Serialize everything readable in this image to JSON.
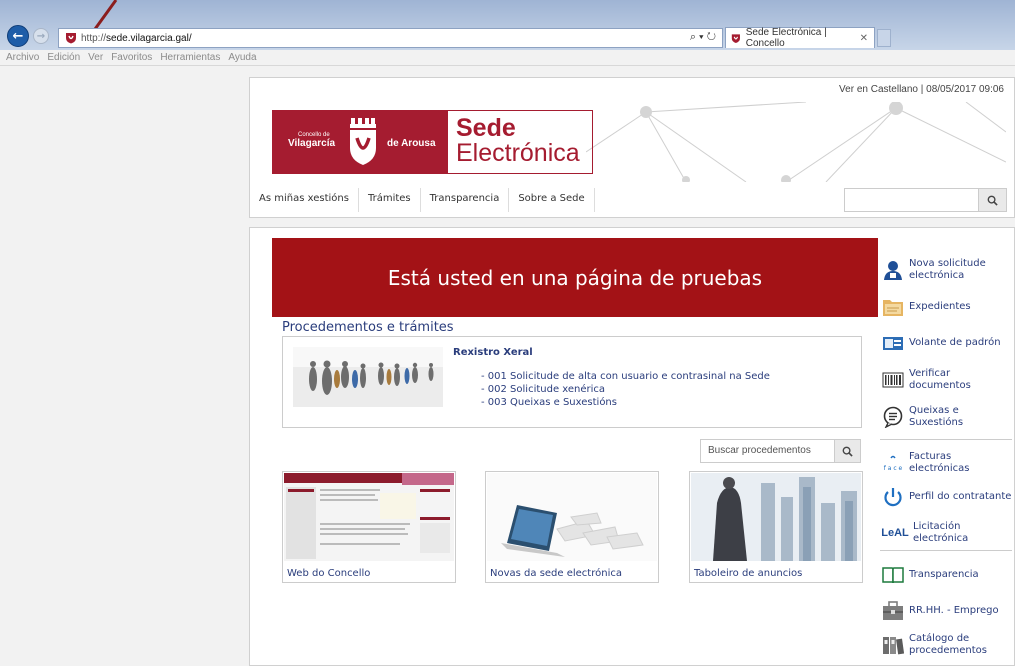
{
  "browser": {
    "url_prefix": "http://",
    "url_domain": "sede.vilagarcia.gal/",
    "address_tools": "⌕ ▾ ↻",
    "tab_title": "Sede Electrónica | Concello",
    "tab_close": "✕",
    "menu": [
      "Archivo",
      "Edición",
      "Ver",
      "Favoritos",
      "Herramientas",
      "Ayuda"
    ]
  },
  "header": {
    "top_line": "Ver en Castellano | 08/05/2017 09:06",
    "logo_concello_small": "Concello de",
    "logo_city": "Vilagarcía",
    "logo_suffix": "de Arousa",
    "logo_sede": "Sede",
    "logo_electronica": "Electrónica",
    "nav": [
      "As miñas xestións",
      "Trámites",
      "Transparencia",
      "Sobre a Sede"
    ],
    "search_icon": "search-icon"
  },
  "main": {
    "test_banner": "Está usted en una página de pruebas",
    "procedures_title": "Procedementos e trámites",
    "registry_title": "Rexistro Xeral",
    "registry_items": [
      "- 001 Solicitude de alta con usuario e contrasinal na Sede",
      "- 002 Solicitude xenérica",
      "- 003 Queixas e Suxestións"
    ],
    "search_placeholder": "Buscar procedementos",
    "cards": [
      {
        "caption": "Web do Concello"
      },
      {
        "caption": "Novas da sede electrónica"
      },
      {
        "caption": "Taboleiro de anuncios"
      }
    ]
  },
  "sidebar": {
    "items": [
      {
        "label": "Nova solicitude electrónica",
        "icon": "person-icon"
      },
      {
        "label": "Expedientes",
        "icon": "folder-icon"
      },
      {
        "label": "Volante de padrón",
        "icon": "id-card-icon"
      },
      {
        "label": "Verificar documentos",
        "icon": "barcode-icon"
      },
      {
        "label": "Queixas e Suxestións",
        "icon": "speech-bubble-icon"
      },
      {
        "label": "Facturas electrónicas",
        "icon": "face-icon"
      },
      {
        "label": "Perfil do contratante",
        "icon": "power-icon"
      },
      {
        "label": "Licitación electrónica",
        "icon": "leal-icon"
      },
      {
        "label": "Transparencia",
        "icon": "book-icon"
      },
      {
        "label": "RR.HH. - Emprego",
        "icon": "briefcase-icon"
      },
      {
        "label": "Catálogo de procedementos",
        "icon": "binders-icon"
      }
    ],
    "face_text": "f a c e",
    "leal_text": "LeAL"
  },
  "colors": {
    "brand_red": "#a51c30",
    "banner_red": "#a31216",
    "link_blue": "#2a3d7c"
  }
}
